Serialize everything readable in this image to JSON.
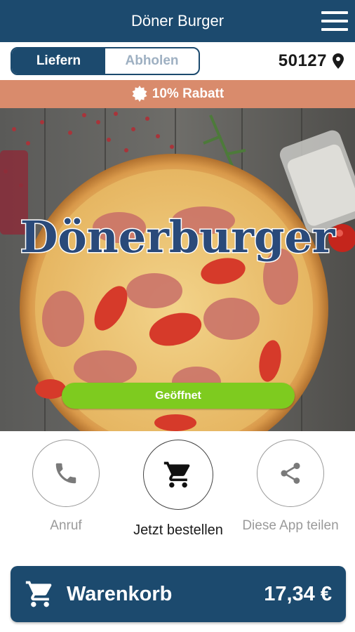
{
  "header": {
    "title": "Döner Burger",
    "menu_icon": "hamburger-menu-icon"
  },
  "order_mode": {
    "options": [
      "Liefern",
      "Abholen"
    ],
    "selected": "Liefern"
  },
  "location": {
    "zip": "50127",
    "icon": "map-pin-icon"
  },
  "discount": {
    "icon": "starburst-badge-icon",
    "text": "10% Rabatt"
  },
  "hero": {
    "logo_text": "Dönerburger",
    "status": "Geöffnet"
  },
  "actions": [
    {
      "label": "Anruf",
      "icon": "phone-icon"
    },
    {
      "label": "Jetzt bestellen",
      "icon": "cart-icon"
    },
    {
      "label": "Diese App teilen",
      "icon": "share-icon"
    }
  ],
  "cart": {
    "label": "Warenkorb",
    "total": "17,34 €",
    "icon": "cart-icon"
  },
  "colors": {
    "primary": "#1c4a6e",
    "discount_bar": "#d98b6c",
    "open_status": "#7ecb1f"
  }
}
